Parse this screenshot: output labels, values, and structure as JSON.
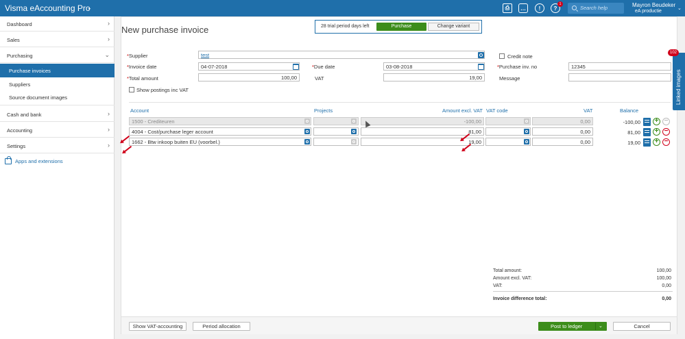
{
  "topbar": {
    "app_title": "Visma eAccounting Pro",
    "app_caret": "⌄",
    "notification_count": "1",
    "search_placeholder": "Search help",
    "user_name": "Mayron Beudeker",
    "user_company": "eA productie",
    "user_caret": "⌄"
  },
  "sidebar": {
    "items": [
      {
        "label": "Dashboard",
        "chevron": "›"
      },
      {
        "label": "Sales",
        "chevron": "›"
      },
      {
        "label": "Purchasing",
        "chevron": "⌄"
      },
      {
        "label": "Cash and bank",
        "chevron": "›"
      },
      {
        "label": "Accounting",
        "chevron": "›"
      },
      {
        "label": "Settings",
        "chevron": "›"
      }
    ],
    "sub_items": [
      {
        "label": "Purchase invoices",
        "active": true
      },
      {
        "label": "Suppliers",
        "active": false
      },
      {
        "label": "Source document images",
        "active": false
      }
    ],
    "apps_label": "Apps and extensions"
  },
  "page": {
    "title": "New purchase invoice",
    "trial_text": "28 trial period days left",
    "trial_button": "Purchase",
    "variant_button": "Change variant"
  },
  "form": {
    "required_mark": "*",
    "supplier_label": "Supplier",
    "supplier_value": "test",
    "credit_note_label": "Credit note",
    "invoice_date_label": "Invoice date",
    "invoice_date_value": "04-07-2018",
    "due_date_label": "Due date",
    "due_date_value": "03-08-2018",
    "purchase_inv_no_label": "Purchase inv. no",
    "purchase_inv_no_value": "12345",
    "total_amount_label": "Total amount",
    "total_amount_value": "100,00",
    "vat_label": "VAT",
    "vat_value": "19,00",
    "message_label": "Message",
    "message_value": "",
    "show_postings_label": "Show postings inc VAT"
  },
  "table": {
    "headers": {
      "account": "Account",
      "projects": "Projects",
      "amount_excl_vat": "Amount excl. VAT",
      "vat_code": "VAT code",
      "vat": "VAT",
      "balance": "Balance"
    },
    "add_symbol": "+",
    "remove_symbol": "−",
    "rows": [
      {
        "account": "1500 - Crediteuren",
        "amount": "-100,00",
        "vat": "0,00",
        "balance": "-100,00"
      },
      {
        "account": "4004 - Cost/purchase leger account",
        "amount": "81,00",
        "vat": "0,00",
        "balance": "81,00"
      },
      {
        "account": "1662 - Btw inkoop buiten EU (voorbel.)",
        "amount": "19,00",
        "vat": "0,00",
        "balance": "19,00"
      }
    ]
  },
  "totals": {
    "total_amount_label": "Total amount:",
    "total_amount_value": "100,00",
    "amount_excl_vat_label": "Amount excl. VAT:",
    "amount_excl_vat_value": "100,00",
    "vat_label": "VAT:",
    "vat_value": "0,00",
    "difference_label": "Invoice difference total:",
    "difference_value": "0,00"
  },
  "footer": {
    "show_vat_button": "Show VAT-accounting",
    "period_allocation_button": "Period allocation",
    "post_button": "Post to ledger",
    "post_caret": "⌄",
    "cancel_button": "Cancel"
  },
  "linked_images": {
    "label": "Linked images",
    "count": "102"
  },
  "colors": {
    "brand_blue": "#1f6faa",
    "action_green": "#3c8d1b",
    "alert_red": "#d0021b"
  }
}
